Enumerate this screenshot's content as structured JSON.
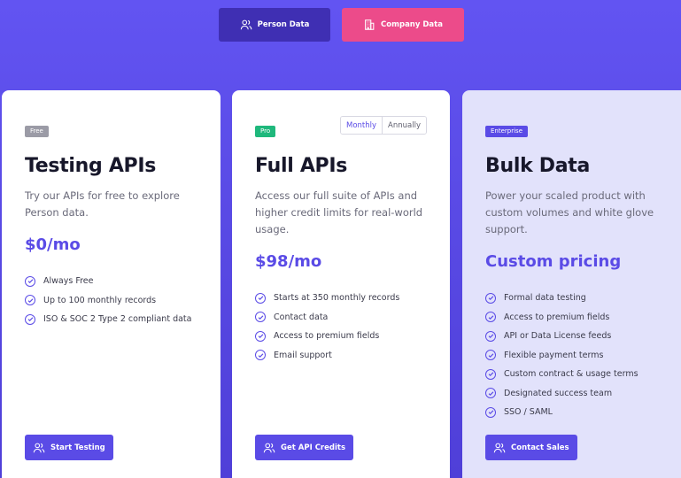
{
  "tabs": {
    "person_label": "Person Data",
    "company_label": "Company Data"
  },
  "colors": {
    "accent": "#5a4be6",
    "person_tab": "#3f2fb3",
    "company_tab": "#ec4b8a",
    "pro_badge": "#1fb87c"
  },
  "billing": {
    "monthly": "Monthly",
    "annually": "Annually",
    "selected": "Monthly"
  },
  "plans": [
    {
      "badge": "Free",
      "title": "Testing APIs",
      "description": "Try our APIs for free to explore Person data.",
      "price": "$0/mo",
      "features": [
        "Always Free",
        "Up to 100 monthly records",
        "ISO & SOC 2 Type 2 compliant data"
      ],
      "cta": "Start Testing"
    },
    {
      "badge": "Pro",
      "title": "Full APIs",
      "description": "Access our full suite of APIs and higher credit limits for real-world usage.",
      "price": "$98/mo",
      "features": [
        "Starts at 350 monthly records",
        "Contact data",
        "Access to premium fields",
        "Email support"
      ],
      "cta": "Get API Credits"
    },
    {
      "badge": "Enterprise",
      "title": "Bulk Data",
      "description": "Power your scaled product with custom volumes and white glove support.",
      "price": "Custom pricing",
      "features": [
        "Formal data testing",
        "Access to premium fields",
        "API or Data License feeds",
        "Flexible payment terms",
        "Custom contract & usage terms",
        "Designated success team",
        "SSO / SAML"
      ],
      "cta": "Contact Sales"
    }
  ]
}
